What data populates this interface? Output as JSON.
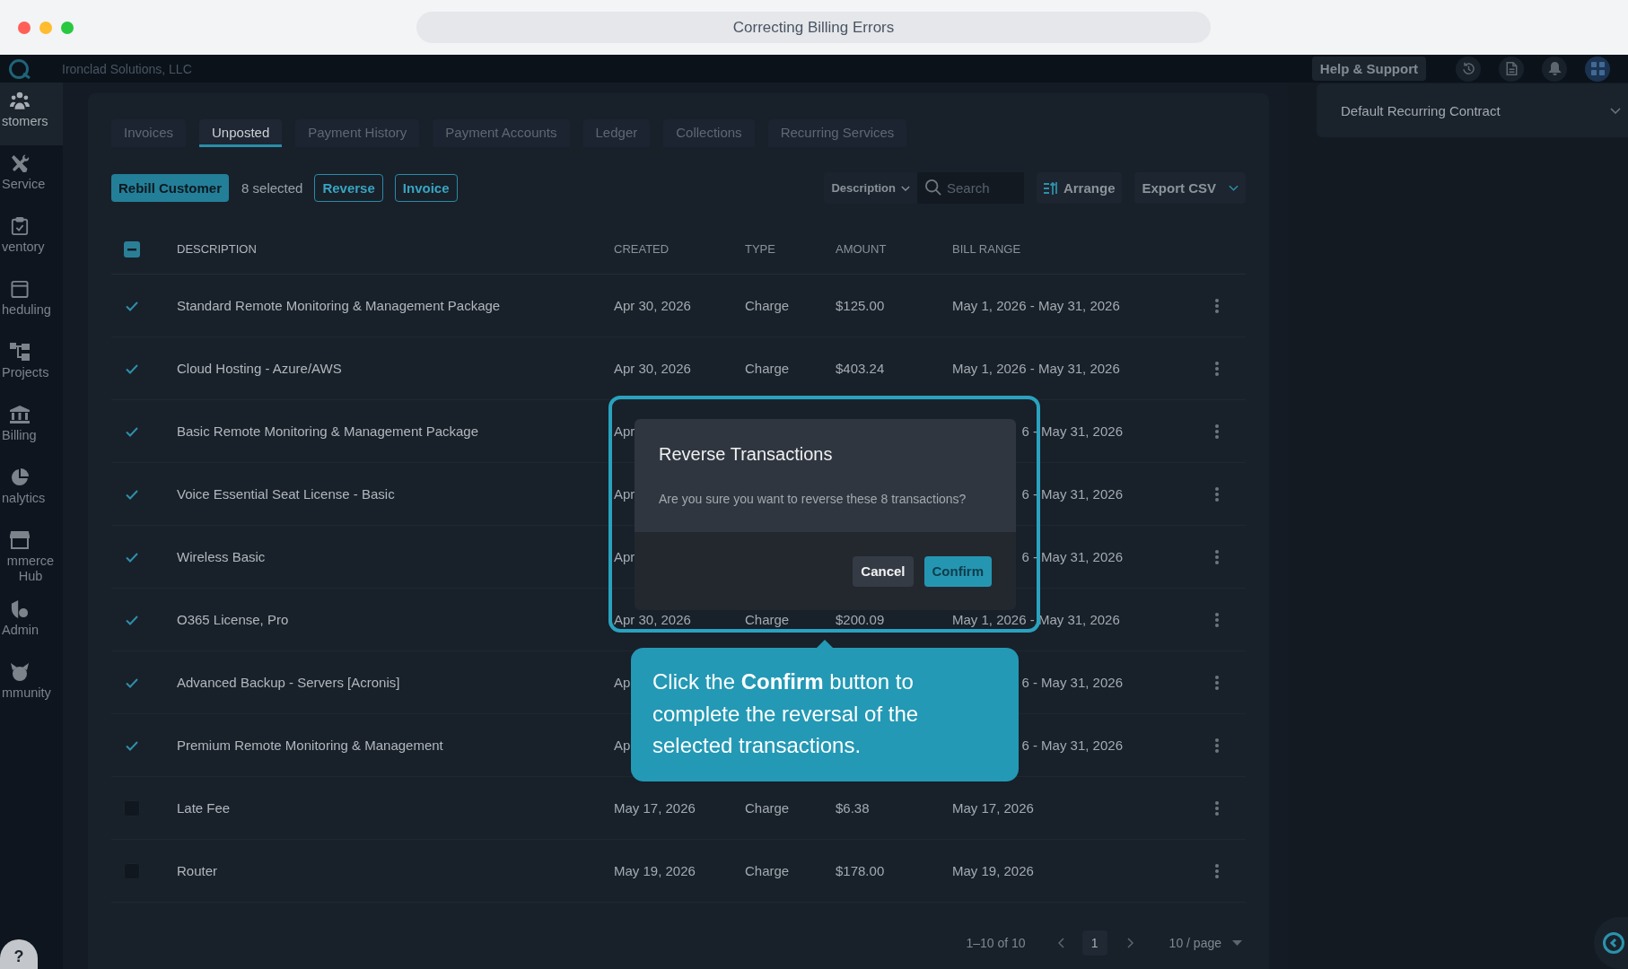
{
  "browser": {
    "title": "Correcting Billing Errors"
  },
  "header": {
    "company": "Ironclad Solutions, LLC",
    "help_button": "Help & Support"
  },
  "sidebar": {
    "items": [
      {
        "label": "stomers",
        "selected": true
      },
      {
        "label": "Service",
        "selected": false
      },
      {
        "label": "ventory",
        "selected": false
      },
      {
        "label": "heduling",
        "selected": false
      },
      {
        "label": "Projects",
        "selected": false
      },
      {
        "label": "Billing",
        "selected": false
      },
      {
        "label": "nalytics",
        "selected": false
      },
      {
        "label": "mmerce Hub",
        "selected": false
      },
      {
        "label": "Admin",
        "selected": false
      },
      {
        "label": "mmunity",
        "selected": false
      }
    ],
    "help_button": "?"
  },
  "tabs": [
    {
      "label": "Invoices",
      "selected": false
    },
    {
      "label": "Unposted",
      "selected": true
    },
    {
      "label": "Payment History",
      "selected": false
    },
    {
      "label": "Payment Accounts",
      "selected": false
    },
    {
      "label": "Ledger",
      "selected": false
    },
    {
      "label": "Collections",
      "selected": false
    },
    {
      "label": "Recurring Services",
      "selected": false
    }
  ],
  "toolbar": {
    "primary_button": "Rebill Customer",
    "selection_count": "8 selected",
    "buttons": [
      "Reverse",
      "Invoice"
    ],
    "filter_dropdown": "Description",
    "search": {
      "placeholder": "Search"
    },
    "arrange_button": "Arrange",
    "export_button": "Export CSV"
  },
  "table": {
    "select_all": {
      "indeterminate": true
    },
    "columns": [
      "DESCRIPTION",
      "CREATED",
      "TYPE",
      "AMOUNT",
      "BILL RANGE"
    ],
    "rows": [
      {
        "kind": "full",
        "checked": true,
        "description": "Standard Remote Monitoring & Management Package",
        "created": "Apr 30, 2026",
        "type": "Charge",
        "amount": "$125.00",
        "bill_range": "May 1, 2026 - May 31, 2026"
      },
      {
        "kind": "full",
        "checked": true,
        "description": "Cloud Hosting - Azure/AWS",
        "created": "Apr 30, 2026",
        "type": "Charge",
        "amount": "$403.24",
        "bill_range": "May 1, 2026 - May 31, 2026"
      },
      {
        "kind": "obscured",
        "checked": true,
        "description": "Basic Remote Monitoring & Management Package",
        "created": "Apr",
        "bill_range": "6 - May 31, 2026"
      },
      {
        "kind": "obscured",
        "checked": true,
        "description": "Voice Essential Seat License - Basic",
        "created": "Apr",
        "bill_range": "6 - May 31, 2026"
      },
      {
        "kind": "obscured",
        "checked": true,
        "description": "Wireless Basic",
        "created": "Apr",
        "bill_range": "6 - May 31, 2026"
      },
      {
        "kind": "full",
        "checked": true,
        "description": "O365 License, Pro",
        "created": "Apr 30, 2026",
        "type": "Charge",
        "amount": "$200.09",
        "bill_range": "May 1, 2026 - May 31, 2026"
      },
      {
        "kind": "obscured",
        "checked": true,
        "description": "Advanced Backup - Servers [Acronis]",
        "created": "Ap",
        "bill_range": "6 - May 31, 2026"
      },
      {
        "kind": "obscured",
        "checked": true,
        "description": "Premium Remote Monitoring & Management",
        "created": "Ap",
        "bill_range": "6 - May 31, 2026"
      },
      {
        "kind": "full",
        "checked": false,
        "description": "Late Fee",
        "created": "May 17, 2026",
        "type": "Charge",
        "amount": "$6.38",
        "bill_range": "May 17, 2026"
      },
      {
        "kind": "full",
        "checked": false,
        "description": "Router",
        "created": "May 19, 2026",
        "type": "Charge",
        "amount": "$178.00",
        "bill_range": "May 19, 2026"
      }
    ]
  },
  "pagination": {
    "range": "1–10 of 10",
    "pages": [
      {
        "label": "1",
        "selected": true
      }
    ],
    "page_size": "10 / page"
  },
  "right_panel": {
    "contract": "Default Recurring Contract"
  },
  "dialog": {
    "title": "Reverse Transactions",
    "message": "Are you sure you want to reverse these 8 transactions?",
    "buttons": [
      {
        "label": "Cancel",
        "kind": "secondary"
      },
      {
        "label": "Confirm",
        "kind": "primary"
      }
    ]
  },
  "callout": {
    "text": "Click the **Confirm** button to complete the reversal of the selected transactions."
  }
}
